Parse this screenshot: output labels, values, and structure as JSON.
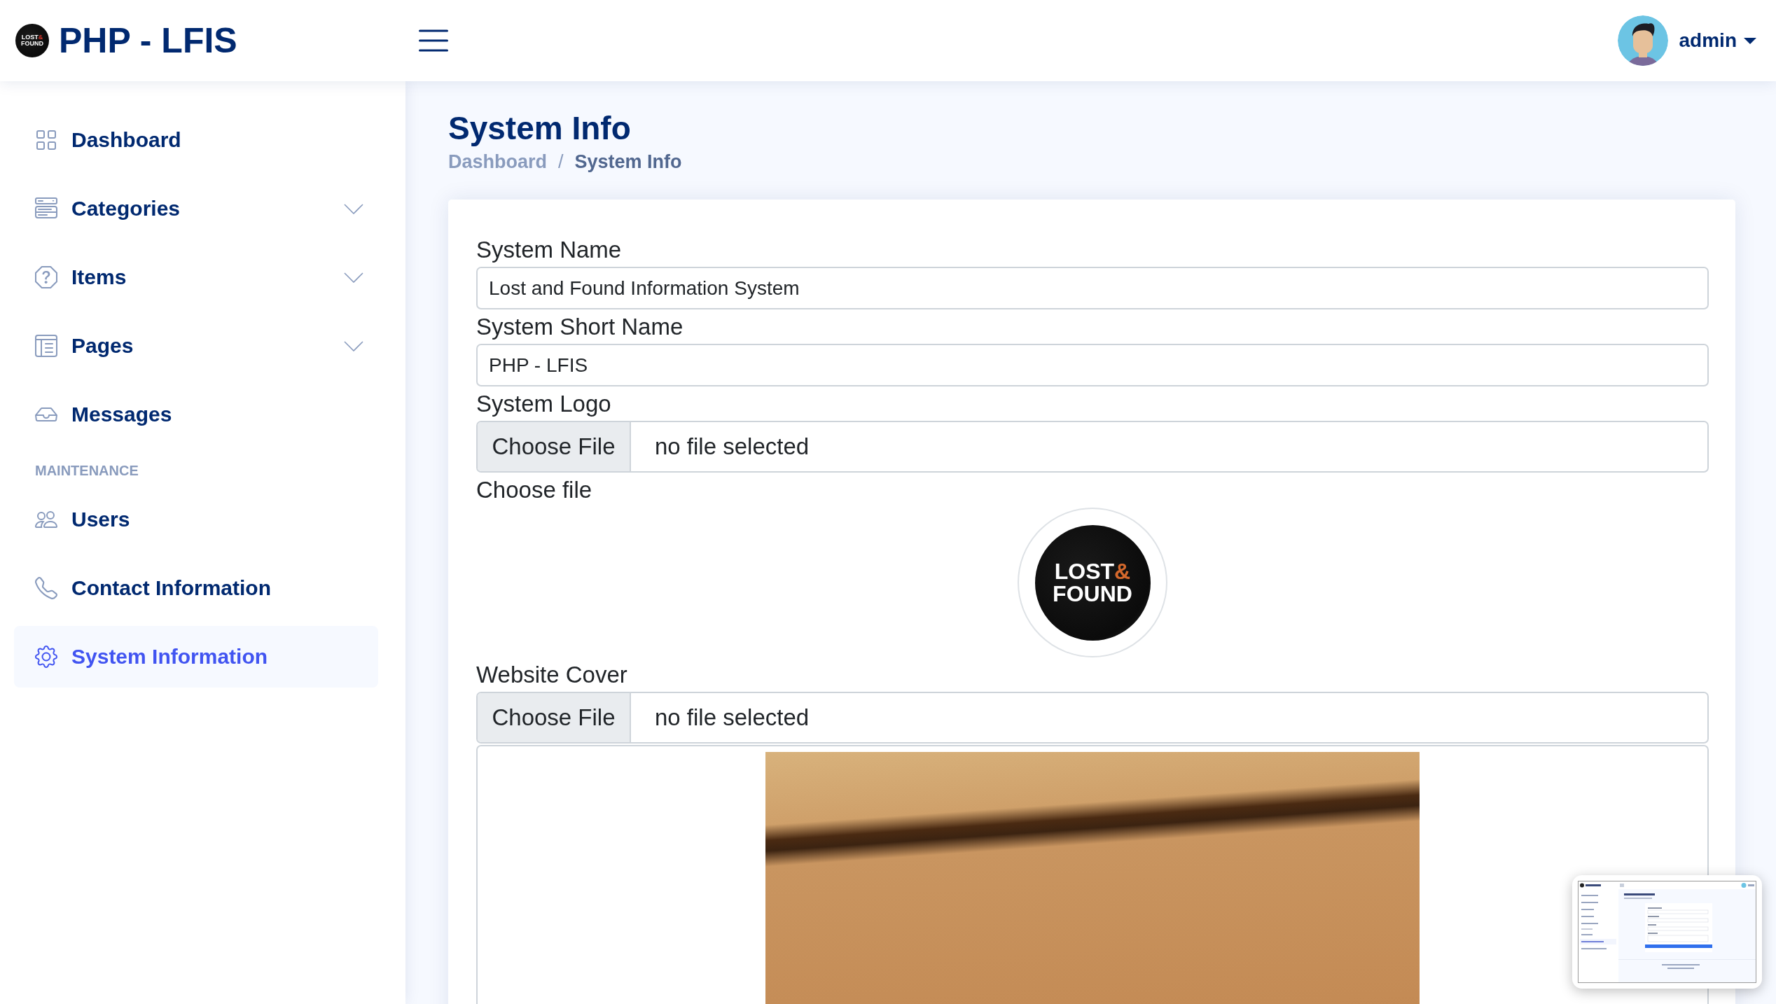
{
  "header": {
    "logo": {
      "line_1": "LOST",
      "accent": "&",
      "line_2": "FOUND"
    },
    "brand_name": "PHP - LFIS",
    "user": {
      "name": "admin"
    }
  },
  "sidebar": {
    "items": [
      {
        "kind": "link",
        "label": "Dashboard",
        "selected": false
      },
      {
        "kind": "group",
        "label": "Categories",
        "selected": false,
        "expanded": false
      },
      {
        "kind": "group",
        "label": "Items",
        "selected": false,
        "expanded": false
      },
      {
        "kind": "group",
        "label": "Pages",
        "selected": false,
        "expanded": false
      },
      {
        "kind": "link",
        "label": "Messages",
        "selected": false
      },
      {
        "kind": "heading",
        "label": "MAINTENANCE"
      },
      {
        "kind": "link",
        "label": "Users",
        "selected": false
      },
      {
        "kind": "link",
        "label": "Contact Information",
        "selected": false
      },
      {
        "kind": "link",
        "label": "System Information",
        "selected": true
      }
    ]
  },
  "page": {
    "title": "System Info",
    "breadcrumb": {
      "separator": "/",
      "items": [
        {
          "label": "Dashboard",
          "selected": false
        },
        {
          "label": "System Info",
          "selected": true
        }
      ]
    }
  },
  "form": {
    "fields": [
      {
        "kind": "text",
        "label": "System Name",
        "value": "Lost and Found Information System"
      },
      {
        "kind": "text",
        "label": "System Short Name",
        "value": "PHP - LFIS"
      },
      {
        "kind": "file",
        "label": "System Logo",
        "button": "Choose File",
        "status": "no file selected",
        "hint": "Choose file",
        "preview": {
          "kind": "logo",
          "line_1": "LOST",
          "accent": "&",
          "line_2": "FOUND"
        }
      },
      {
        "kind": "file",
        "label": "Website Cover",
        "button": "Choose File",
        "status": "no file selected",
        "preview": {
          "kind": "photo"
        }
      }
    ]
  },
  "overlay": {
    "kind": "screenshot_thumbnail"
  }
}
